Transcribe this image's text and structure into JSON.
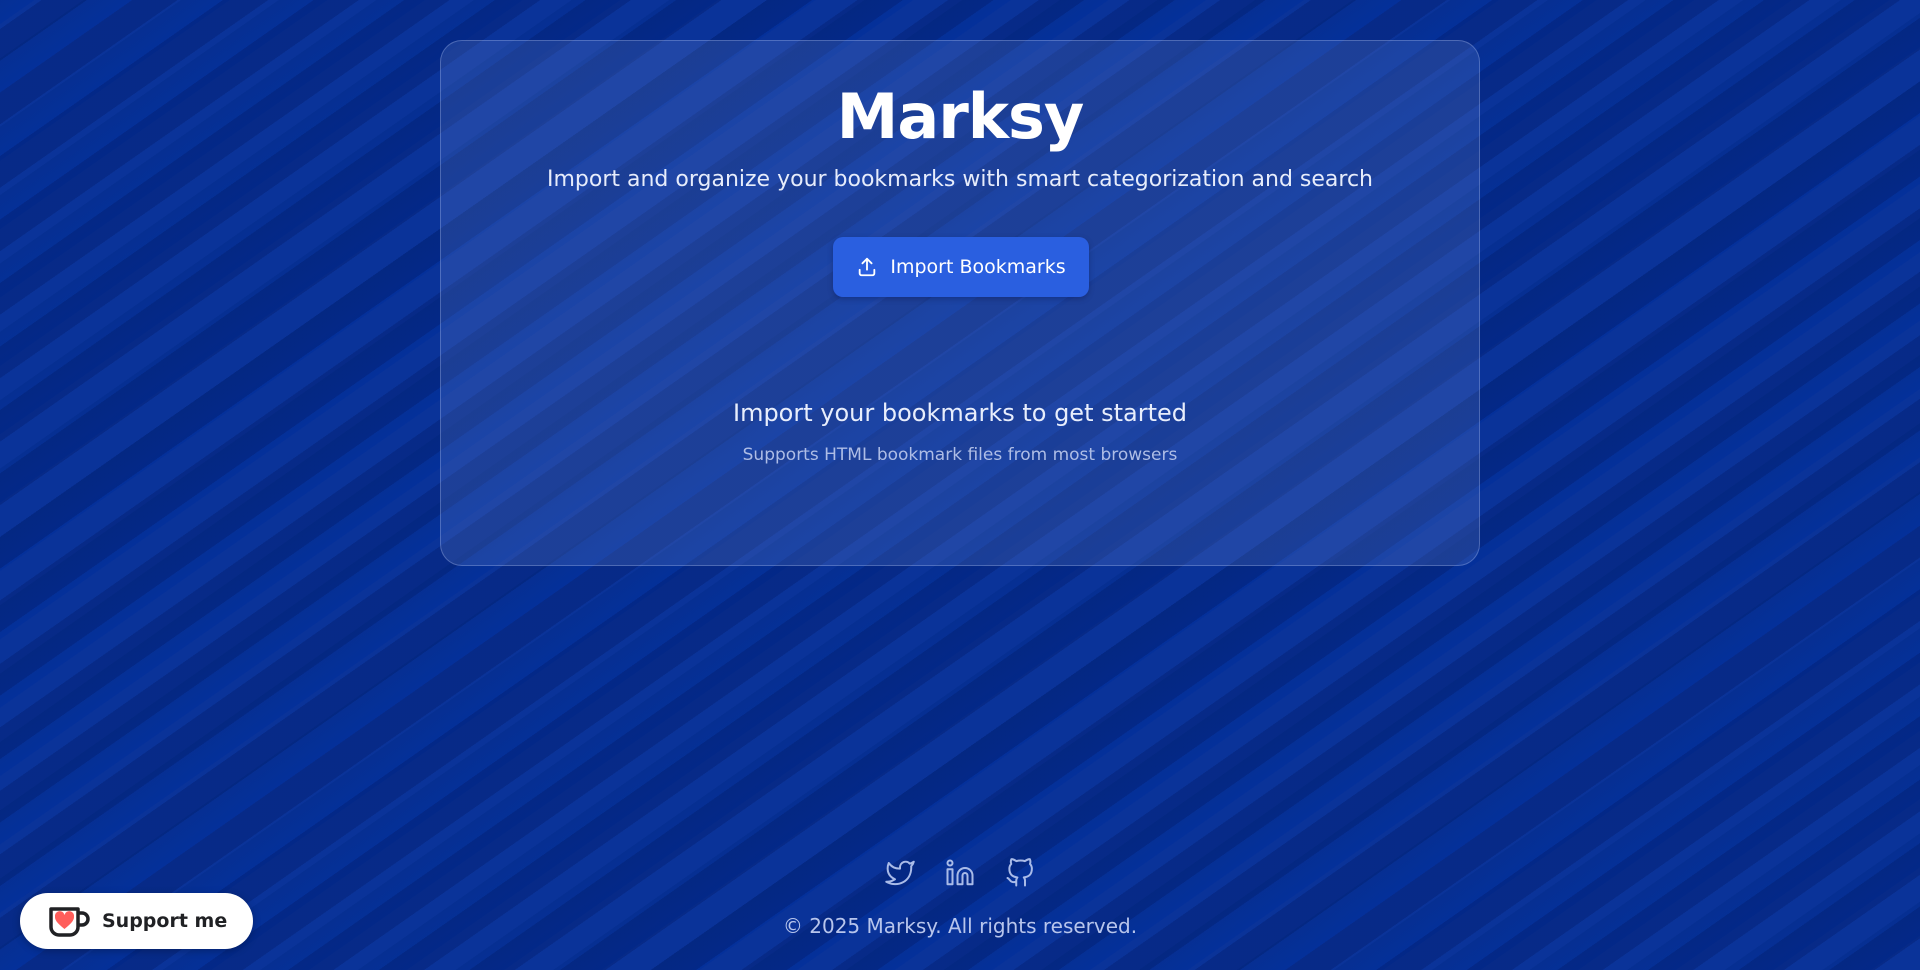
{
  "app": {
    "title": "Marksy",
    "tagline": "Import and organize your bookmarks with smart categorization and search"
  },
  "import_button": {
    "label": "Import Bookmarks",
    "icon": "upload-icon"
  },
  "empty_state": {
    "title": "Import your bookmarks to get started",
    "hint": "Supports HTML bookmark files from most browsers"
  },
  "footer": {
    "social": [
      {
        "icon": "twitter-icon"
      },
      {
        "icon": "linkedin-icon"
      },
      {
        "icon": "github-icon"
      }
    ],
    "copyright": "© 2025 Marksy. All rights reserved."
  },
  "support": {
    "label": "Support me",
    "icon": "ko-fi-cup-icon"
  },
  "colors": {
    "background": "#0a3399",
    "button": "#2a5fe0",
    "heart": "#ff5e5b"
  }
}
